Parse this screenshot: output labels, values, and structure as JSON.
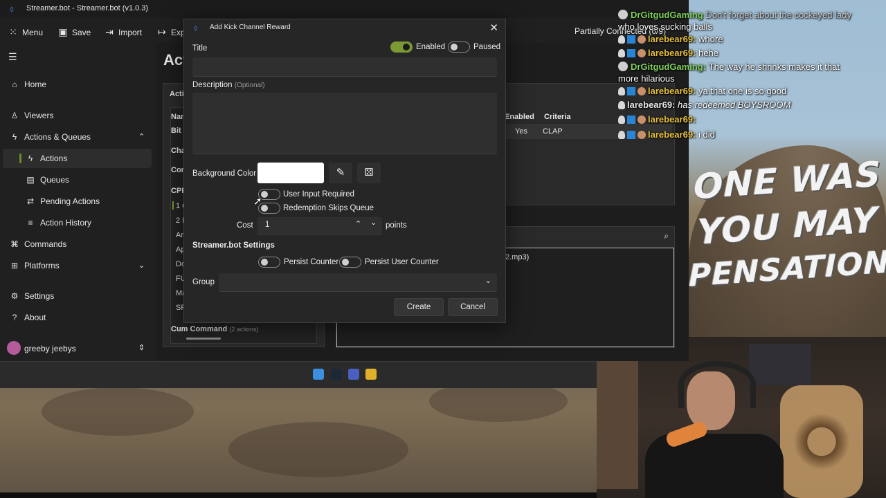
{
  "app": {
    "title": "Streamer.bot - Streamer.bot (v1.0.3)",
    "toolbar": {
      "menu": "Menu",
      "save": "Save",
      "import": "Import",
      "export": "Exp",
      "status": "Partially Connected (6/9)"
    },
    "sidebar": {
      "items": [
        {
          "label": "Home",
          "icon": "home-icon"
        },
        {
          "label": "Viewers",
          "icon": "person-icon"
        },
        {
          "label": "Actions & Queues",
          "icon": "bolt-icon"
        },
        {
          "label": "Actions",
          "icon": "bolt-icon"
        },
        {
          "label": "Queues",
          "icon": "list-icon"
        },
        {
          "label": "Pending Actions",
          "icon": "route-icon"
        },
        {
          "label": "Action History",
          "icon": "history-icon"
        },
        {
          "label": "Commands",
          "icon": "command-icon"
        },
        {
          "label": "Platforms",
          "icon": "grid-icon"
        },
        {
          "label": "Settings",
          "icon": "gear-icon"
        },
        {
          "label": "About",
          "icon": "question-icon"
        }
      ],
      "user": "greeby jeebys"
    },
    "content": {
      "heading": "Act",
      "left_fragments": [
        "Acti",
        "Nan",
        "Bit",
        "Cha",
        "Con",
        "CPR",
        "1 C",
        "2 R",
        "An",
        "Ap",
        "Do",
        "FU",
        "Ma",
        "SP"
      ],
      "cum_command": "Cum Command",
      "cum_count": "(2 actions)",
      "table_headers": [
        "Enabled",
        "Criteria"
      ],
      "table_row": [
        "Yes",
        "CLAP"
      ],
      "mp3_text": "2.mp3)"
    }
  },
  "dialog": {
    "title": "Add Kick Channel Reward",
    "title_label": "Title",
    "enabled_label": "Enabled",
    "paused_label": "Paused",
    "title_value": "",
    "description_label": "Description",
    "description_optional": "(Optional)",
    "description_value": "",
    "background_color_label": "Background Color",
    "background_color": "#ffffff",
    "user_input_required": "User Input Required",
    "redemption_skips_queue": "Redemption Skips Queue",
    "cost_label": "Cost",
    "cost_value": "1",
    "points_label": "points",
    "section_streamerbot": "Streamer.bot Settings",
    "persist_counter": "Persist Counter",
    "persist_user_counter": "Persist User Counter",
    "group_label": "Group",
    "group_value": "",
    "create_label": "Create",
    "cancel_label": "Cancel",
    "toggles": {
      "enabled": true,
      "paused": false,
      "user_input_required": false,
      "redemption_skips_queue": false,
      "persist_counter": false,
      "persist_user_counter": false
    }
  },
  "chat": [
    {
      "user": "DrGitgudGaming",
      "msg": "Don't forget about the cockeyed lady",
      "color": "#7fd15a"
    },
    {
      "user": "",
      "msg": "who loves sucking balls",
      "color": "#ffffff"
    },
    {
      "user": "larebear69:",
      "msg": "whore",
      "color": "#e8c03a"
    },
    {
      "user": "larebear69:",
      "msg": "hehe",
      "color": "#e8c03a"
    },
    {
      "user": "DrGitgudGaming:",
      "msg": "The way he shrinks makes it that",
      "color": "#7fd15a"
    },
    {
      "user": "",
      "msg": "more hilarious",
      "color": "#ffffff"
    },
    {
      "user": "larebear69:",
      "msg": "ya that one is so good",
      "color": "#e8c03a"
    },
    {
      "user": "larebear69:",
      "msg": "has redeemed BOYSROOM",
      "color": "#ffffff"
    },
    {
      "user": "larebear69:",
      "msg": "",
      "color": "#e8c03a"
    },
    {
      "user": "larebear69:",
      "msg": "i did",
      "color": "#e8c03a"
    }
  ],
  "meme": {
    "line1": "ONE WAS",
    "line2": "YOU MAY",
    "line3": "PENSATION"
  }
}
